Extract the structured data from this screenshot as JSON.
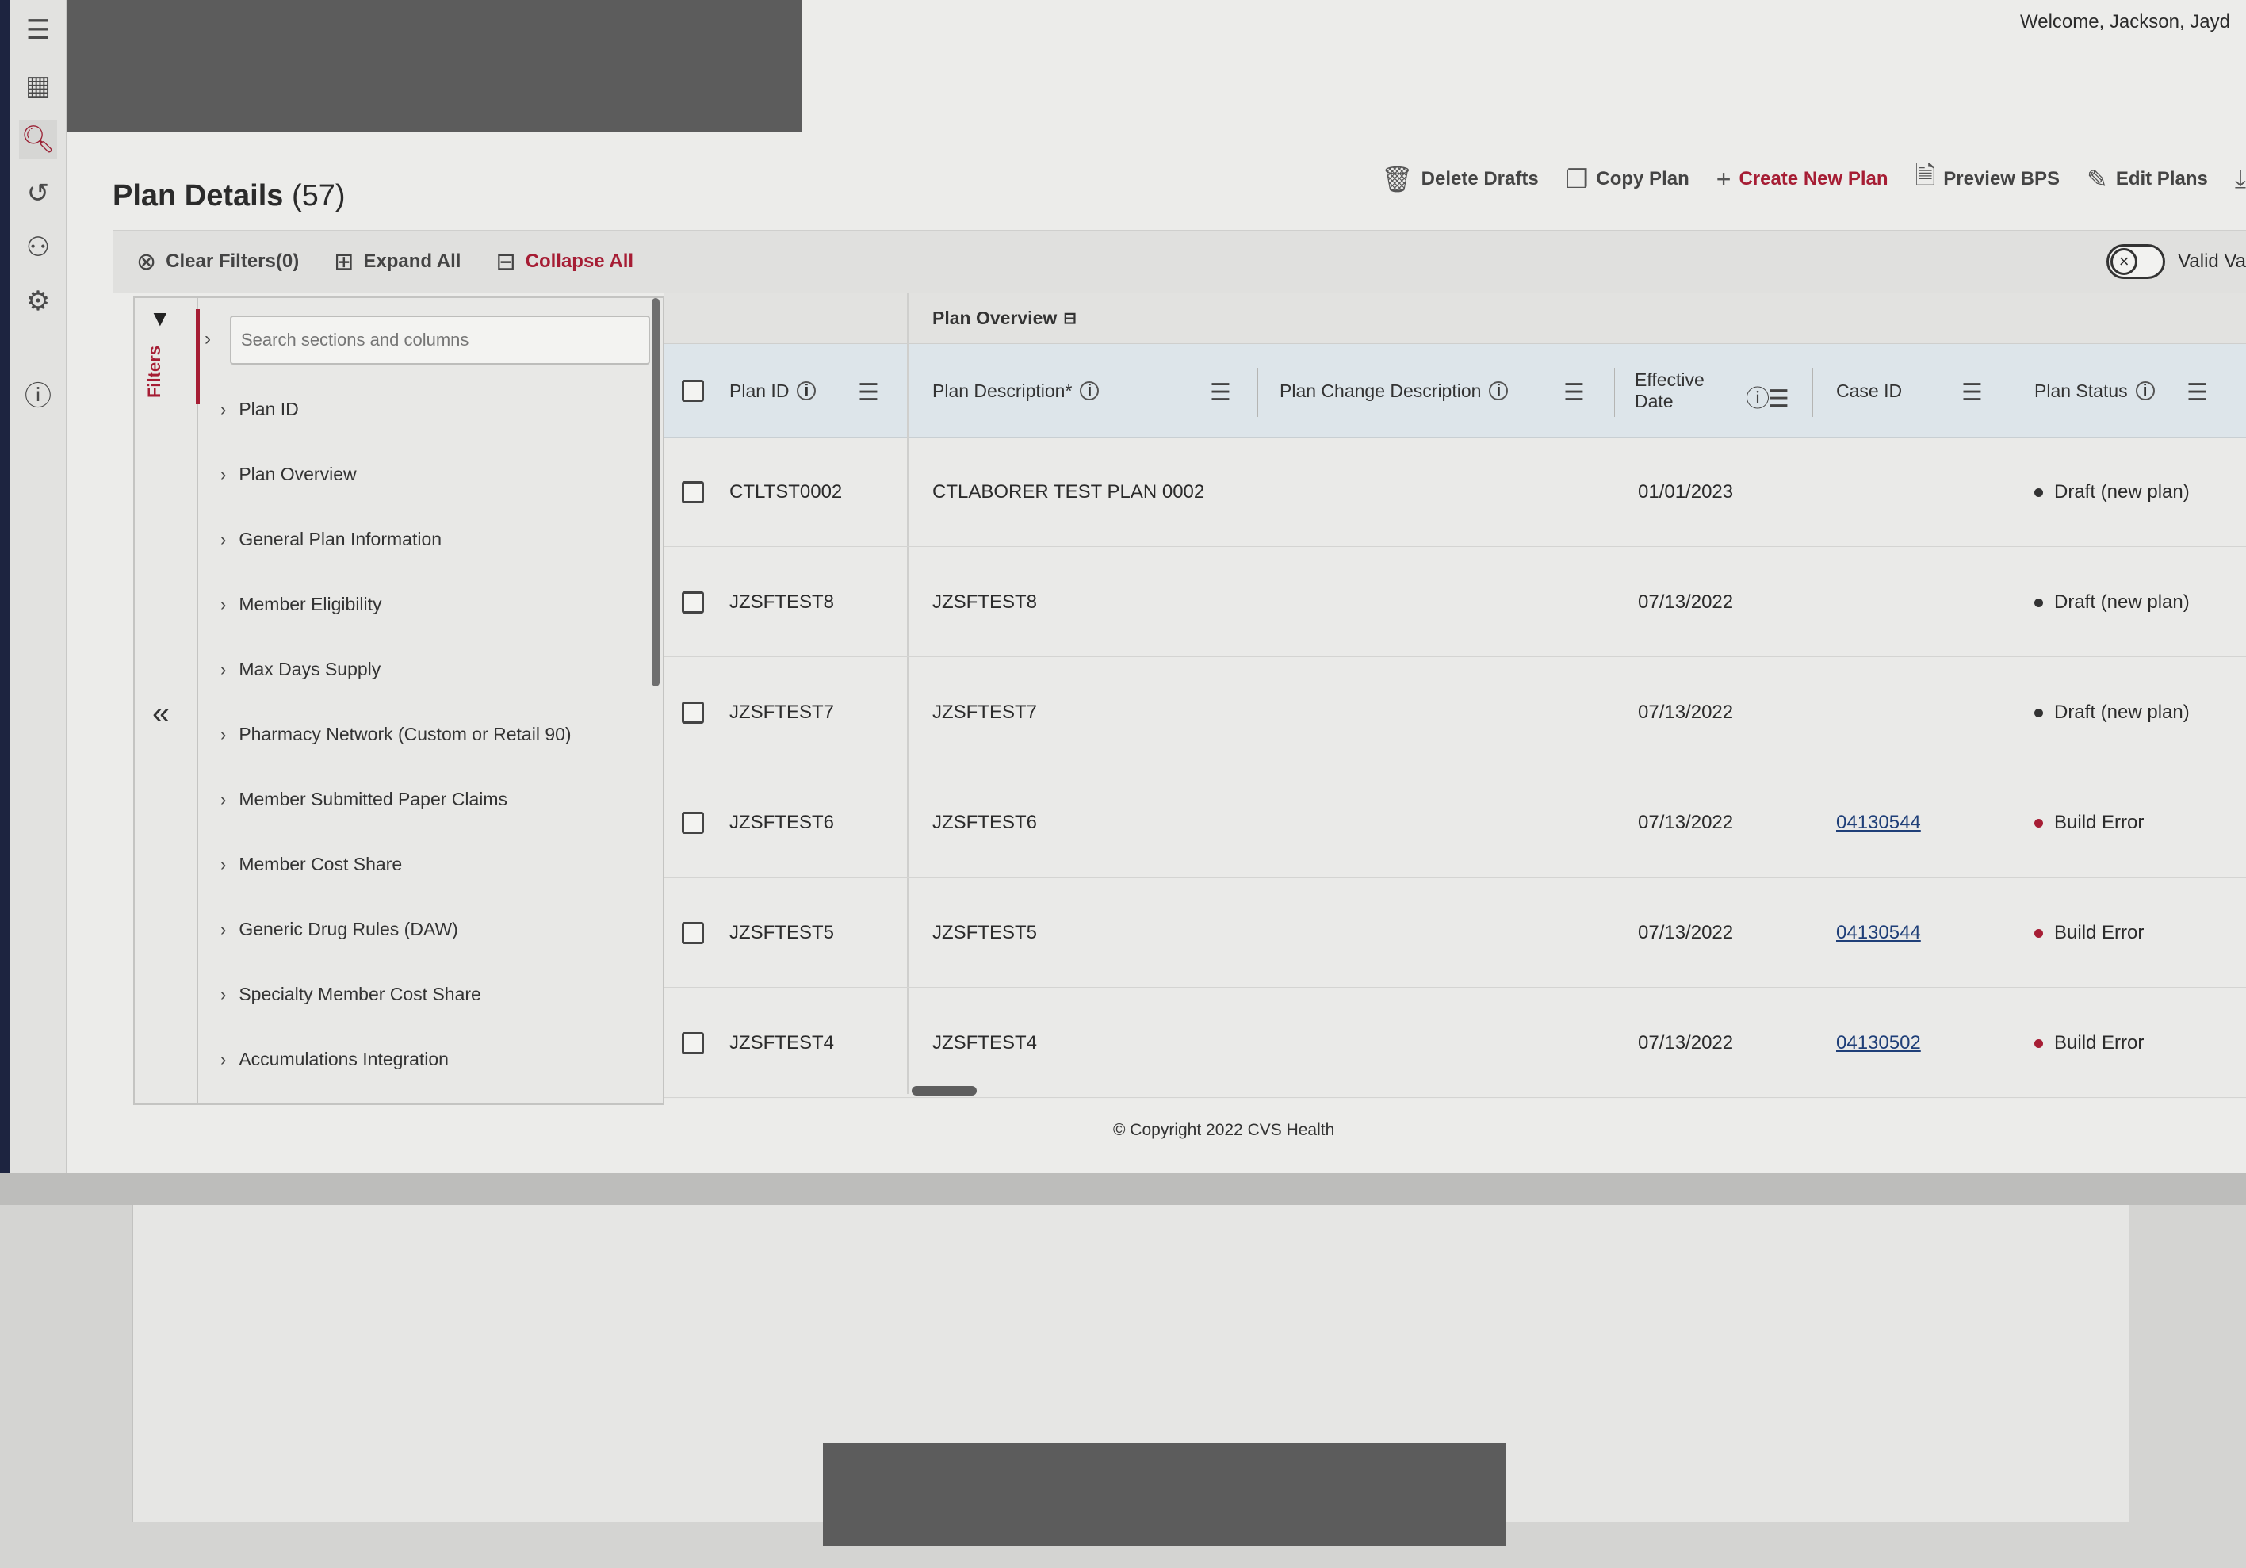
{
  "header": {
    "welcome": "Welcome, Jackson, Jayd"
  },
  "nav": {
    "items": [
      "menu-icon",
      "dashboard-icon",
      "plan-search-icon",
      "history-icon",
      "user-management-icon",
      "settings-icon",
      "help-icon"
    ],
    "active": "plan-search-icon",
    "accent": "#a61d34"
  },
  "page": {
    "title": "Plan Details",
    "count": "(57)"
  },
  "toolbar": {
    "delete_drafts": "Delete Drafts",
    "copy_plan": "Copy Plan",
    "create_new_plan": "Create New Plan",
    "preview_bps": "Preview BPS",
    "edit_plans": "Edit Plans"
  },
  "filterbar": {
    "clear_filters": "Clear Filters(0)",
    "expand_all": "Expand All",
    "collapse_all": "Collapse All",
    "valid_label": "Valid Va"
  },
  "sidepanel": {
    "filters_label": "Filters",
    "search_placeholder": "Search sections and columns",
    "sections": [
      "Plan ID",
      "Plan Overview",
      "General Plan Information",
      "Member Eligibility",
      "Max Days Supply",
      "Pharmacy Network (Custom or Retail 90)",
      "Member Submitted Paper Claims",
      "Member Cost Share",
      "Generic Drug Rules (DAW)",
      "Specialty Member Cost Share",
      "Accumulations Integration"
    ]
  },
  "grid": {
    "group_label": "Plan Overview",
    "columns": {
      "plan_id": "Plan ID",
      "plan_description": "Plan Description*",
      "plan_change_description": "Plan Change Description",
      "effective_date_line1": "Effective",
      "effective_date_line2": "Date",
      "case_id": "Case ID",
      "plan_status": "Plan Status"
    },
    "rows": [
      {
        "plan_id": "CTLTST0002",
        "description": "CTLABORER TEST PLAN 0002",
        "change": "",
        "effective": "01/01/2023",
        "case_id": "",
        "status": "Draft (new plan)",
        "status_color": "#333333"
      },
      {
        "plan_id": "JZSFTEST8",
        "description": "JZSFTEST8",
        "change": "",
        "effective": "07/13/2022",
        "case_id": "",
        "status": "Draft (new plan)",
        "status_color": "#333333"
      },
      {
        "plan_id": "JZSFTEST7",
        "description": "JZSFTEST7",
        "change": "",
        "effective": "07/13/2022",
        "case_id": "",
        "status": "Draft (new plan)",
        "status_color": "#333333"
      },
      {
        "plan_id": "JZSFTEST6",
        "description": "JZSFTEST6",
        "change": "",
        "effective": "07/13/2022",
        "case_id": "04130544",
        "status": "Build Error",
        "status_color": "#a61d34"
      },
      {
        "plan_id": "JZSFTEST5",
        "description": "JZSFTEST5",
        "change": "",
        "effective": "07/13/2022",
        "case_id": "04130544",
        "status": "Build Error",
        "status_color": "#a61d34"
      },
      {
        "plan_id": "JZSFTEST4",
        "description": "JZSFTEST4",
        "change": "",
        "effective": "07/13/2022",
        "case_id": "04130502",
        "status": "Build Error",
        "status_color": "#a61d34"
      }
    ]
  },
  "footer": {
    "copyright": "© Copyright 2022 CVS Health"
  }
}
